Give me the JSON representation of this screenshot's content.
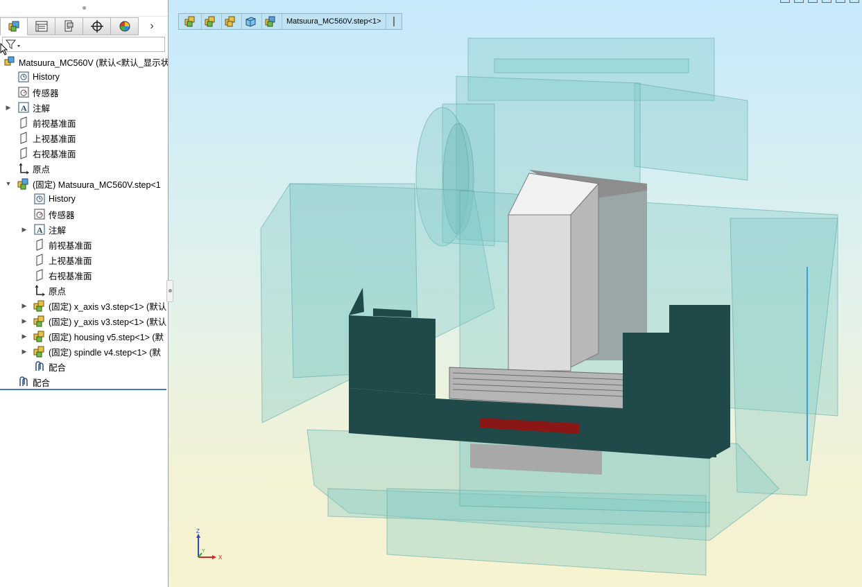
{
  "tabs": [
    {
      "name": "feature-manager-tab",
      "icon": "assembly-icon"
    },
    {
      "name": "property-manager-tab",
      "icon": "property-list-icon"
    },
    {
      "name": "configuration-manager-tab",
      "icon": "configuration-icon"
    },
    {
      "name": "dimxpert-tab",
      "icon": "crosshair-icon"
    },
    {
      "name": "display-manager-tab",
      "icon": "appearance-icon"
    }
  ],
  "tabs_more_glyph": "›",
  "filter": {
    "icon": "filter-icon",
    "value": ""
  },
  "tree": {
    "root_label": "Matsuura_MC560V  (默认<默认_显示状",
    "history": "History",
    "sensors": "传感器",
    "annotations": "注解",
    "front_plane": "前视基准面",
    "top_plane": "上视基准面",
    "right_plane": "右视基准面",
    "origin": "原点",
    "sub": {
      "label": "(固定) Matsuura_MC560V.step<1",
      "history": "History",
      "sensors": "传感器",
      "annotations": "注解",
      "front_plane": "前视基准面",
      "top_plane": "上视基准面",
      "right_plane": "右视基准面",
      "origin": "原点",
      "x_axis": "(固定) x_axis v3.step<1> (默认",
      "y_axis": "(固定) y_axis v3.step<1> (默认",
      "housing": "(固定) housing v5.step<1> (默",
      "spindle": "(固定) spindle v4.step<1> (默",
      "mates": "配合"
    },
    "mates": "配合"
  },
  "breadcrumb": {
    "items": [
      "assembly-icon",
      "assembly-icon",
      "assembly-icon",
      "part-icon",
      "assembly-icon"
    ],
    "label": "Matsuura_MC560V.step<1>"
  },
  "triad": {
    "z": "Z",
    "y": "Y",
    "x": "X"
  },
  "colors": {
    "accent": "#3d7fc1",
    "bed": "#1f4a49",
    "glass": "#7fc8c6",
    "spindle": "#d4d4d4",
    "red_strip": "#8a1616"
  }
}
